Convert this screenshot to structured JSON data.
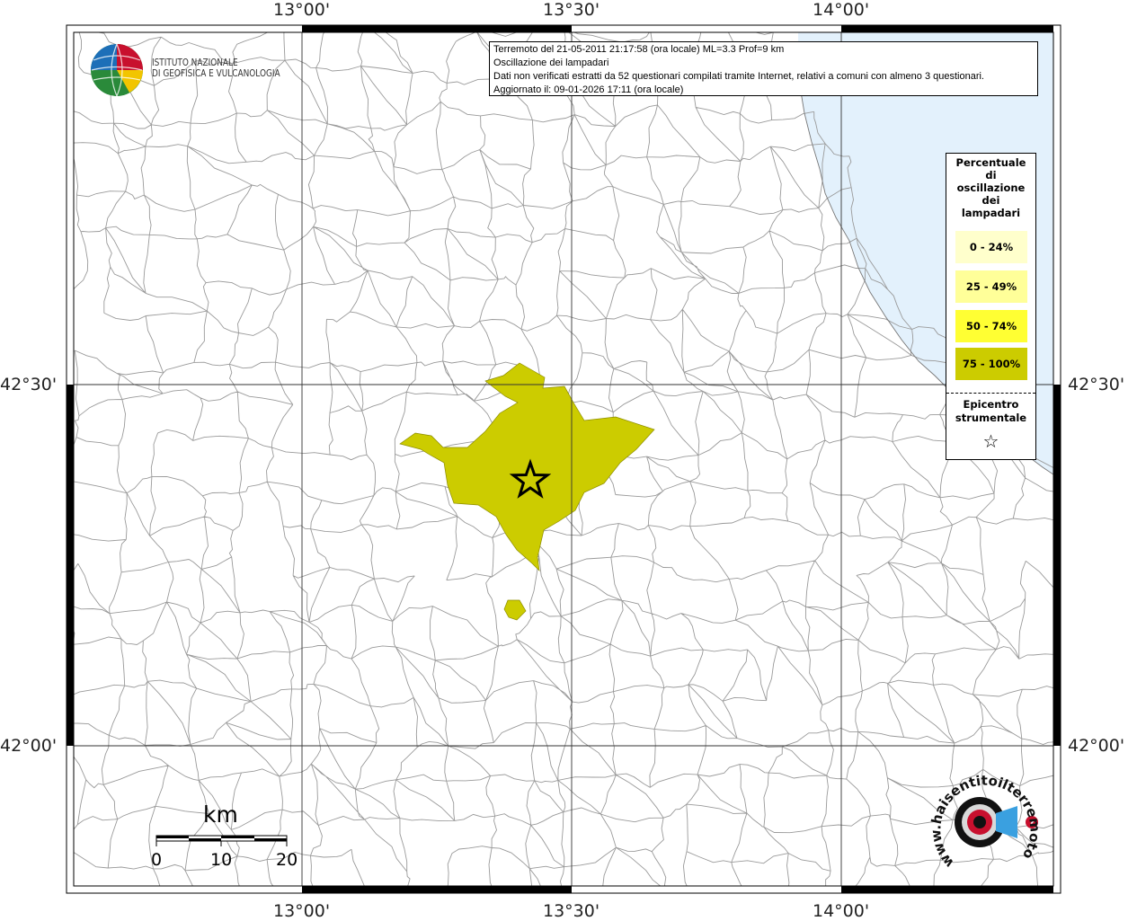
{
  "map": {
    "lon_labels": [
      "13°00'",
      "13°30'",
      "14°00'"
    ],
    "lat_labels": [
      "42°30'",
      "42°00'"
    ],
    "sea_color": "#e3f1fc",
    "felt_color": "#cccc00",
    "border_color": "#9a9a9a"
  },
  "info": {
    "line1": "Terremoto del 21-05-2011 21:17:58 (ora locale) ML=3.3 Prof=9 km",
    "line2": "Oscillazione dei lampadari",
    "line3": "Dati non verificati estratti da 52 questionari compilati tramite Internet, relativi a comuni con almeno 3 questionari.",
    "line4": "Aggiornato il: 09-01-2026 17:11 (ora locale)"
  },
  "legend": {
    "title_lines": [
      "Percentuale",
      "di",
      "oscillazione",
      "dei",
      "lampadari"
    ],
    "classes": [
      {
        "label": "0 - 24%",
        "color": "#ffffcc"
      },
      {
        "label": "25 - 49%",
        "color": "#ffff99"
      },
      {
        "label": "50 - 74%",
        "color": "#ffff33"
      },
      {
        "label": "75 - 100%",
        "color": "#cccc00"
      }
    ],
    "epicenter_lines": [
      "Epicentro",
      "strumentale"
    ],
    "epicenter_symbol": "☆"
  },
  "logo_ingv": {
    "line1": "ISTITUTO NAZIONALE",
    "line2": "DI GEOFISICA E VULCANOLOGIA"
  },
  "scalebar": {
    "unit": "km",
    "ticks": [
      "0",
      "10",
      "20"
    ]
  },
  "logo_hsit": {
    "text": "www.haisentitoilterremoto.it"
  }
}
